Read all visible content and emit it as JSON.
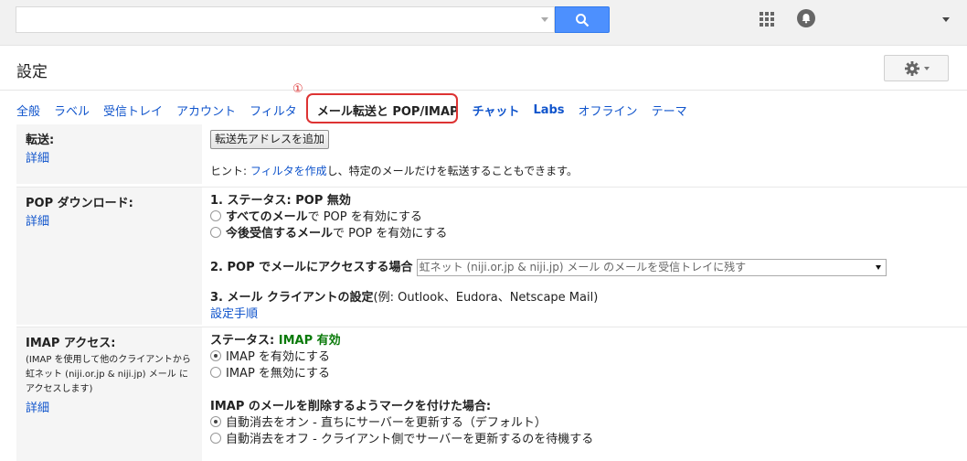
{
  "header": {
    "search_placeholder": "",
    "search_icon": "search-icon",
    "apps_icon": "apps-grid-icon",
    "notifications_icon": "notifications-icon"
  },
  "page": {
    "title": "設定"
  },
  "tabs": [
    {
      "label": "全般"
    },
    {
      "label": "ラベル"
    },
    {
      "label": "受信トレイ"
    },
    {
      "label": "アカウント"
    },
    {
      "label": "フィルタ"
    },
    {
      "label": "メール転送と POP/IMAP"
    },
    {
      "label": "チャット"
    },
    {
      "label": "Labs"
    },
    {
      "label": "オフライン"
    },
    {
      "label": "テーマ"
    }
  ],
  "annotation": {
    "marker": "①",
    "color": "#dd3333"
  },
  "forwarding": {
    "label": "転送:",
    "detail_link": "詳細",
    "add_button": "転送先アドレスを追加",
    "hint_prefix": "ヒント: ",
    "hint_link": "フィルタを作成",
    "hint_suffix": "し、特定のメールだけを転送することもできます。"
  },
  "pop": {
    "label": "POP ダウンロード:",
    "detail_link": "詳細",
    "status_prefix": "1. ステータス: ",
    "status_value": "POP 無効",
    "option1_bold": "すべてのメール",
    "option1_rest": "で POP を有効にする",
    "option2_bold": "今後受信するメール",
    "option2_rest": "で POP を有効にする",
    "access_label": "2. POP でメールにアクセスする場合",
    "access_select": "虹ネット (niji.or.jp & niji.jp) メール のメールを受信トレイに残す",
    "client_label": "3. メール クライアントの設定",
    "client_note": "(例: Outlook、Eudora、Netscape Mail)",
    "setup_link": "設定手順"
  },
  "imap": {
    "label": "IMAP アクセス:",
    "note": "(IMAP を使用して他のクライアントから虹ネット (niji.or.jp & niji.jp) メール にアクセスします)",
    "detail_link": "詳細",
    "status_prefix": "ステータス: ",
    "status_value": "IMAP 有効",
    "enable_option": "IMAP を有効にする",
    "disable_option": "IMAP を無効にする",
    "delete_label": "IMAP のメールを削除するようマークを付けた場合:",
    "expunge_on": "自動消去をオン - 直ちにサーバーを更新する（デフォルト）",
    "expunge_off": "自動消去をオフ - クライアント側でサーバーを更新するのを待機する"
  }
}
